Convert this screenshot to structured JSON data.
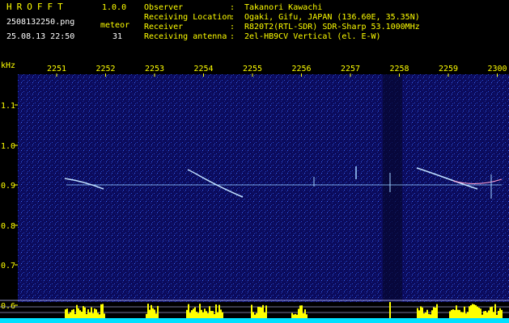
{
  "header": {
    "brand": "HROFFT",
    "version": "1.0.0",
    "filename": "2508132250.png",
    "timestamp": "25.08.13 22:50",
    "meteor_label": "meteor",
    "meteor_count": "31"
  },
  "info": [
    {
      "label": "Observer",
      "value": "Takanori Kawachi"
    },
    {
      "label": "Receiving Location",
      "value": "Ogaki, Gifu, JAPAN (136.60E, 35.35N)"
    },
    {
      "label": "Receiver",
      "value": "R820T2(RTL-SDR) SDR-Sharp 53.1000MHz"
    },
    {
      "label": "Receiving antenna",
      "value": "2el-HB9CV Vertical (el. E-W)"
    }
  ],
  "plot": {
    "y_unit": "kHz",
    "x_ticks": [
      "2251",
      "2252",
      "2253",
      "2254",
      "2255",
      "2256",
      "2257",
      "2258",
      "2259",
      "2300"
    ],
    "y_ticks": [
      "1.1",
      "1.0",
      "0.9",
      "0.8",
      "0.7",
      "0.6"
    ],
    "colors": {
      "background": "#0a0a5a",
      "trace": "#9fd0ff",
      "bars": "#ffff00",
      "baseline": "#00e0ff",
      "axis_text": "#ffff00"
    }
  }
}
